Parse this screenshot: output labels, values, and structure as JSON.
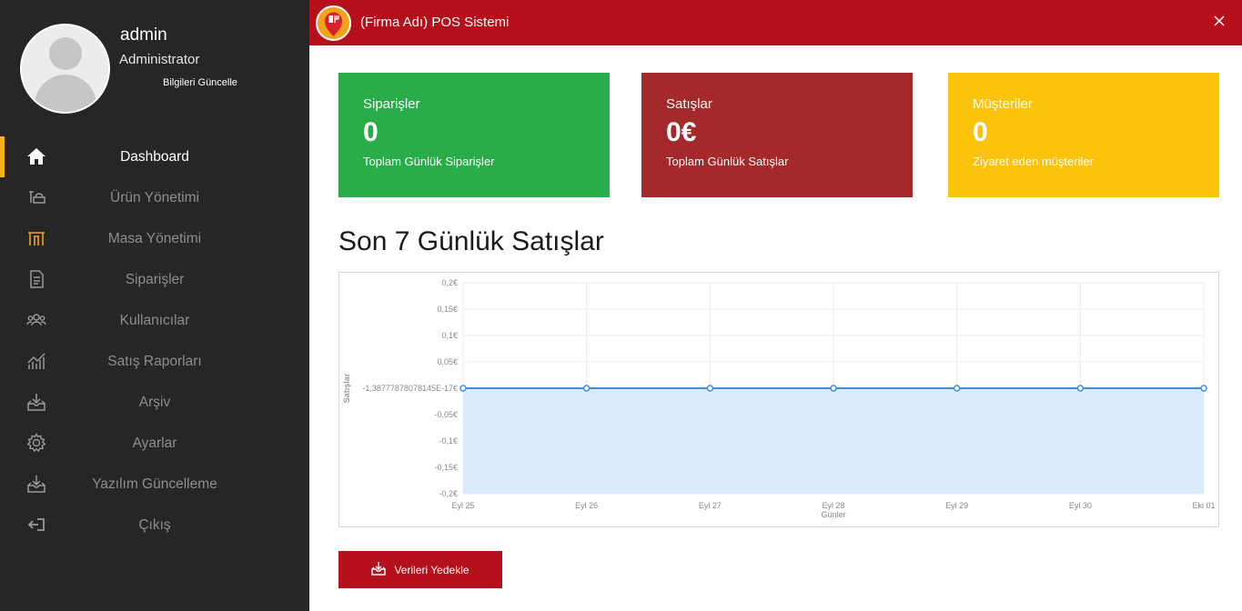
{
  "profile": {
    "username": "admin",
    "role": "Administrator",
    "update_link": "Bilgileri Güncelle"
  },
  "menu": [
    {
      "label": "Dashboard",
      "icon": "home-icon",
      "active": true
    },
    {
      "label": "Ürün Yönetimi",
      "icon": "product-icon",
      "active": false
    },
    {
      "label": "Masa Yönetimi",
      "icon": "table-icon",
      "active": false
    },
    {
      "label": "Siparişler",
      "icon": "order-icon",
      "active": false
    },
    {
      "label": "Kullanıcılar",
      "icon": "users-icon",
      "active": false
    },
    {
      "label": "Satış Raporları",
      "icon": "report-icon",
      "active": false
    },
    {
      "label": "Arşiv",
      "icon": "archive-icon",
      "active": false
    },
    {
      "label": "Ayarlar",
      "icon": "gear-icon",
      "active": false
    },
    {
      "label": "Yazılım Güncelleme",
      "icon": "update-icon",
      "active": false
    },
    {
      "label": "Çıkış",
      "icon": "logout-icon",
      "active": false
    }
  ],
  "topbar": {
    "title": "(Firma Adı) POS Sistemi",
    "close_icon": "close-icon"
  },
  "cards": {
    "orders": {
      "title": "Siparişler",
      "value": "0",
      "subtitle": "Toplam Günlük Siparişler",
      "color": "#29ad4a"
    },
    "sales": {
      "title": "Satışlar",
      "value": "0€",
      "subtitle": "Toplam Günlük Satışlar",
      "color": "#a4292b"
    },
    "customers": {
      "title": "Müşteriler",
      "value": "0",
      "subtitle": "Ziyaret eden müşteriler",
      "color": "#fcc30c"
    }
  },
  "section_title": "Son 7 Günlük Satışlar",
  "chart_data": {
    "type": "area",
    "x": [
      "Eyl 25",
      "Eyl 26",
      "Eyl 27",
      "Eyl 28",
      "Eyl 29",
      "Eyl 30",
      "Eki 01"
    ],
    "y_ticks": [
      "0,2€",
      "0,15€",
      "0,1€",
      "0,05€",
      "-1,38777878078145E-17€",
      "-0,05€",
      "-0,1€",
      "-0,15€",
      "-0,2€"
    ],
    "series": [
      {
        "values": [
          0,
          0,
          0,
          0,
          0,
          0,
          0
        ]
      }
    ],
    "xlabel": "Günler",
    "ylabel": "Satışlar",
    "ylim": [
      -0.2,
      0.2
    ],
    "grid": true,
    "line_color": "#3a8fdc",
    "fill_color": "#dbebfb"
  },
  "backup_button": {
    "label": "Verileri Yedekle",
    "icon": "download-icon"
  },
  "colors": {
    "sidebar": "#262626",
    "accent": "#b5101c",
    "active_marker": "#f3b21a"
  }
}
